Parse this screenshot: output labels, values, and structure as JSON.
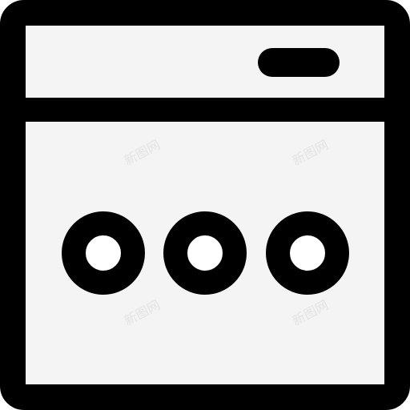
{
  "icon": {
    "name": "browser-window-dots-icon",
    "stroke_color": "#000000",
    "fill_color": "#f4f4f4",
    "background": "#ffffff"
  },
  "watermark": {
    "text": "新图网"
  }
}
